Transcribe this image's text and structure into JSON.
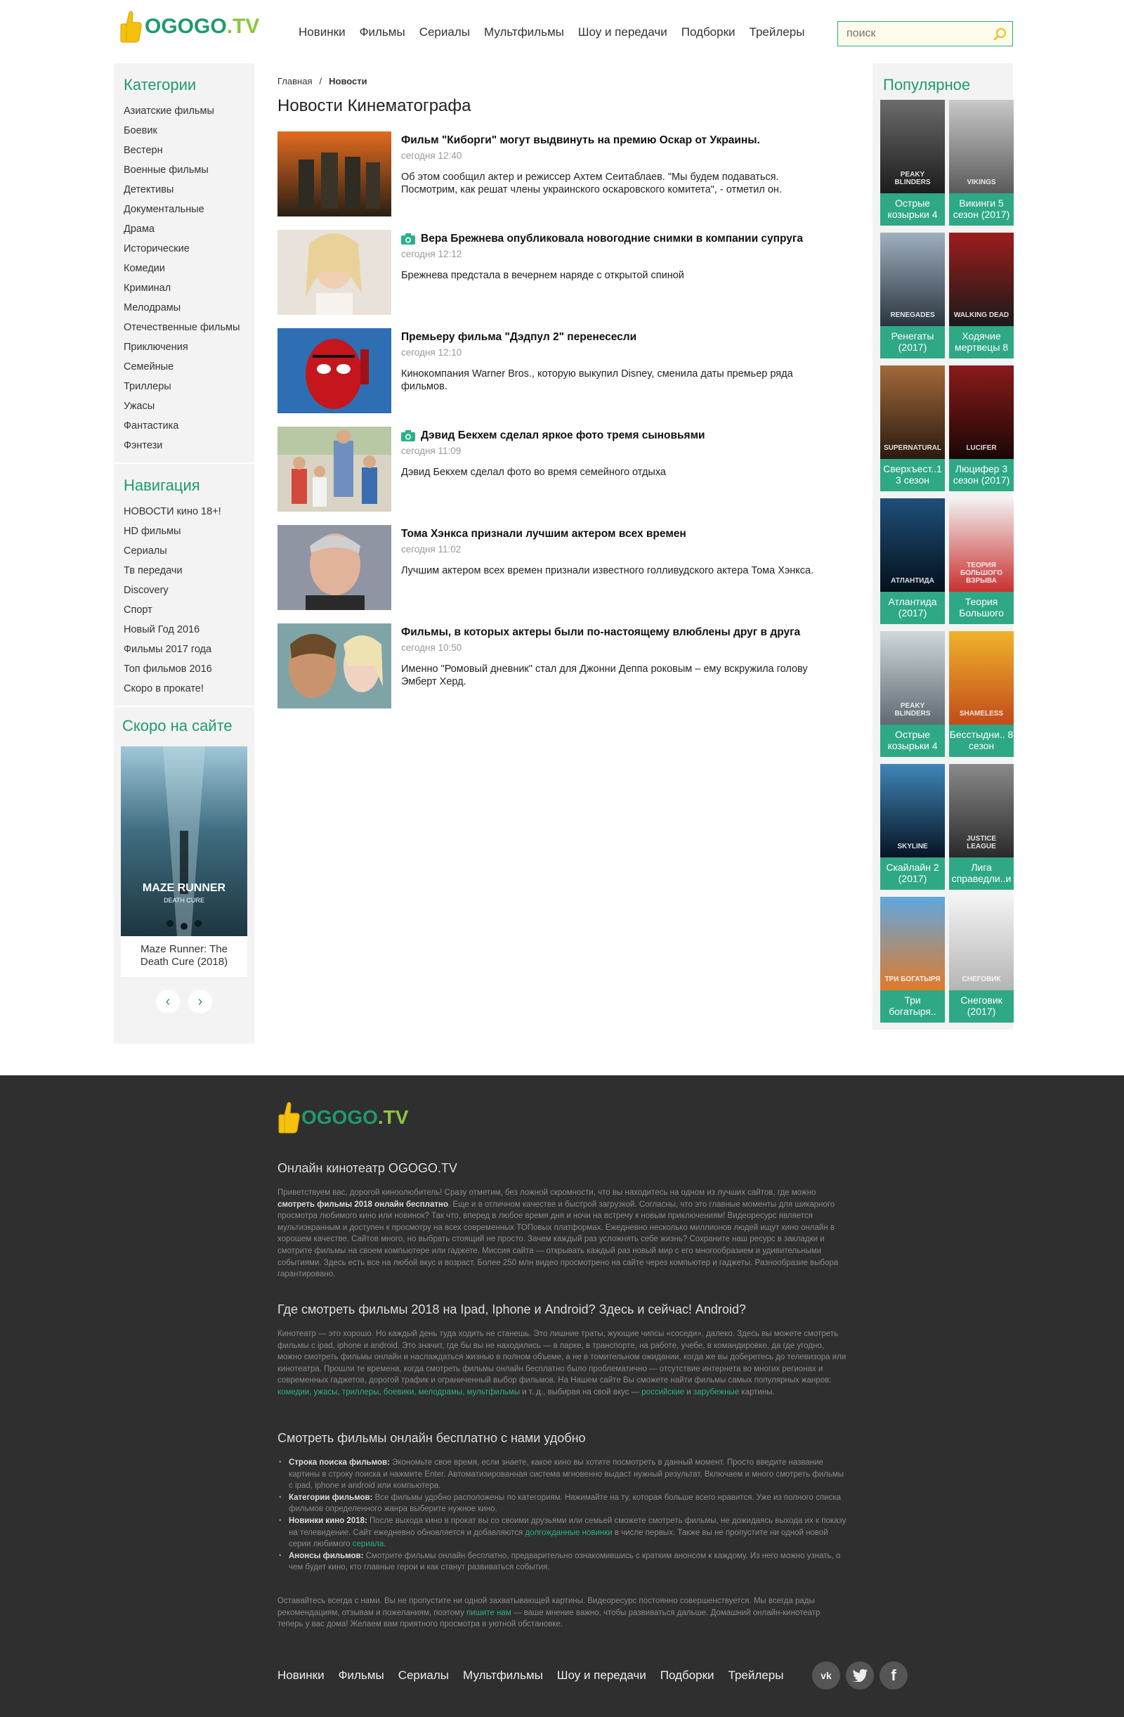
{
  "logo": {
    "part1": "OGOGO",
    "part2": ".TV"
  },
  "topnav": [
    "Новинки",
    "Фильмы",
    "Сериалы",
    "Мультфильмы",
    "Шоу и передачи",
    "Подборки",
    "Трейлеры"
  ],
  "search": {
    "placeholder": "поиск"
  },
  "categories": {
    "title": "Категории",
    "items": [
      "Азиатские фильмы",
      "Боевик",
      "Вестерн",
      "Военные фильмы",
      "Детективы",
      "Документальные",
      "Драма",
      "Исторические",
      "Комедии",
      "Криминал",
      "Мелодрамы",
      "Отечественные фильмы",
      "Приключения",
      "Семейные",
      "Триллеры",
      "Ужасы",
      "Фантастика",
      "Фэнтези"
    ]
  },
  "navigation": {
    "title": "Навигация",
    "items": [
      "НОВОСТИ кино 18+!",
      "HD фильмы",
      "Сериалы",
      "Тв передачи",
      "Discovery",
      "Спорт",
      "Новый Год 2016",
      "Фильмы 2017 года",
      "Топ фильмов 2016",
      "Скоро в прокате!"
    ]
  },
  "soon": {
    "title": "Скоро на сайте",
    "card_title": "Maze Runner: The Death Cure (2018)",
    "poster_text": "MAZE RUNNER",
    "poster_sub": "DEATH CURE"
  },
  "breadcrumb": {
    "home": "Главная",
    "separator": "/",
    "current": "Новости"
  },
  "page_title": "Новости Кинематографа",
  "news": [
    {
      "title": "Фильм \"Киборги\" могут выдвинуть на премию Оскар от Украины.",
      "time": "сегодня 12:40",
      "desc": "Об этом сообщил актер и режиссер Ахтем Сеитаблаев. \"Мы будем подаваться. Посмотрим, как решат члены украинского оскаровского комитета\", - отметил он.",
      "photo": false
    },
    {
      "title": "Вера Брежнева опубликовала новогодние снимки в компании супруга",
      "time": "сегодня 12:12",
      "desc": "Брежнева предстала в вечернем наряде с открытой спиной",
      "photo": true
    },
    {
      "title": "Премьеру фильма \"Дэдпул 2\" перенесесли",
      "time": "сегодня 12:10",
      "desc": "Кинокомпания Warner Bros., которую выкупил Disney, сменила даты премьер ряда фильмов.",
      "photo": false
    },
    {
      "title": "Дэвид Бекхем сделал яркое фото тремя сыновьями",
      "time": "сегодня 11:09",
      "desc": "Дэвид Бекхем сделал фото во время семейного отдыха",
      "photo": true
    },
    {
      "title": "Тома Хэнкса признали лучшим актером всех времен",
      "time": "сегодня 11:02",
      "desc": "Лучшим актером всех времен признали известного голливудского актера Тома Хэнкса.",
      "photo": false
    },
    {
      "title": "Фильмы, в которых актеры были по-настоящему влюблены друг в друга",
      "time": "сегодня 10:50",
      "desc": "Именно \"Ромовый дневник\" стал для Джонни Деппа роковым – ему вскружила голову Эмберт Херд.",
      "photo": false
    }
  ],
  "popular": {
    "title": "Популярное",
    "items": [
      {
        "title": "Острые козырьки 4",
        "color1": "#6b6b6b",
        "color2": "#1c1c1c",
        "poster_text": "PEAKY BLINDERS"
      },
      {
        "title": "Викинги 5 сезон (2017)",
        "color1": "#c9c9c9",
        "color2": "#5a5a5a",
        "poster_text": "VIKINGS"
      },
      {
        "title": "Ренегаты (2017)",
        "color1": "#9fb0be",
        "color2": "#2a3440",
        "poster_text": "RENEGADES"
      },
      {
        "title": "Ходячие мертвецы 8",
        "color1": "#9e1c1c",
        "color2": "#1a1a1a",
        "poster_text": "WALKING DEAD"
      },
      {
        "title": "Сверхъест..1 3 сезон",
        "color1": "#a36a3a",
        "color2": "#2a1a10",
        "poster_text": "SUPERNATURAL"
      },
      {
        "title": "Люцифер 3 сезон (2017)",
        "color1": "#8c1a1a",
        "color2": "#1a0606",
        "poster_text": "LUCIFER"
      },
      {
        "title": "Атлантида (2017)",
        "color1": "#1f4f7a",
        "color2": "#04101c",
        "poster_text": "АТЛАНТИДА"
      },
      {
        "title": "Теория Большого",
        "color1": "#f2f2f2",
        "color2": "#c93030",
        "poster_text": "ТЕОРИЯ БОЛЬШОГО ВЗРЫВА"
      },
      {
        "title": "Острые козырьки 4",
        "color1": "#cfd8dc",
        "color2": "#5d6a70",
        "poster_text": "PEAKY BLINDERS"
      },
      {
        "title": "Бесстыдни.. 8 сезон",
        "color1": "#f0b32a",
        "color2": "#c24b1c",
        "poster_text": "SHAMELESS"
      },
      {
        "title": "Скайлайн 2 (2017)",
        "color1": "#3f86b8",
        "color2": "#061424",
        "poster_text": "SKYLINE"
      },
      {
        "title": "Лига справедли..и",
        "color1": "#8a8a8a",
        "color2": "#2a2a2a",
        "poster_text": "JUSTICE LEAGUE"
      },
      {
        "title": "Три богатыря..",
        "color1": "#5fa8e0",
        "color2": "#e07a2a",
        "poster_text": "ТРИ БОГАТЫРЯ"
      },
      {
        "title": "Снеговик (2017)",
        "color1": "#f2f2f2",
        "color2": "#b5b5b5",
        "poster_text": "СНЕГОВИК"
      }
    ]
  },
  "footer": {
    "h1": "Онлайн кинотеатр OGOGO.TV",
    "p1_a": "Приветствуем вас, дорогой киноолюбитель! Сразу отметим, без ложной скромности, что вы находитесь на одном из лучших сайтов, где можно ",
    "p1_b": "смотреть фильмы 2018 онлайн бесплатно",
    "p1_c": ". Еще и в отличном качестве и быстрой загрузкой. Согласны, что это главные моменты для шикарного просмотра любимого кино или новинок? Так что, вперед в любое время дня и ночи на встречу к новым приключениям! Видеоресурс является мультиэкранным и доступен к просмотру на всех современных ТОПовых платформах. Ежедневно несколько миллионов людей ищут кино онлайн в хорошем качестве. Сайтов много, но выбрать стоящий не просто. Зачем каждый раз усложнять себе жизнь? Сохраните наш ресурс в закладки и смотрите фильмы на своем компьютере или гаджете. Миссия сайта — открывать каждый раз новый мир с его многообразием и удивительными событиями. Здесь есть все на любой вкус и возраст. Более 250 млн видео просмотрено на сайте через компьютер и гаджеты. Разнообразие выбора гарантировано.",
    "h2": "Где смотреть фильмы 2018 на Ipad, Iphone и Android? Здесь и сейчас! Android?",
    "p2_a": "Кинотеатр — это хорошо. Но каждый день туда ходить не станешь. Это лишние траты, жующие чипсы «соседи», далеко. Здесь вы можете смотреть фильмы с ipad, iphone и android. Это значит, где бы вы не находились — в парке, в транспорте, на работе, учебе, в командировке, да где угодно, можно смотреть фильмы онлайн и наслаждаться жизнью в полном объеме, а не в томительном ожидании, когда же вы доберетесь до телевизора или кинотеатра. Прошли те времена, когда смотреть фильмы онлайн бесплатно было проблематично — отсутствие интернета во многих регионах и современных гаджетов, дорогой трафик и ограниченный выбор фильмов. На Нашем сайте Вы сможете найти фильмы самых популярных жанров: ",
    "p2_links": "комедии, ужасы, триллеры, боевики, мелодрамы, мультфильмы",
    "p2_b": " и т. д., выбирая на свой вкус — ",
    "p2_link2": "российские",
    "p2_c": " и ",
    "p2_link3": "зарубежные",
    "p2_d": " картины.",
    "h3": "Смотреть фильмы онлайн бесплатно с нами удобно",
    "list": [
      {
        "b": "Строка поиска фильмов:",
        "t": " Экономьте свое время, если знаете, какое кино вы хотите посмотреть в данный момент. Просто введите название картины в строку поиска и нажмите Enter. Автоматизированная система мгновенно выдаст нужный результат. Включаем и много смотреть фильмы с ipad, iphone и android или компьютера."
      },
      {
        "b": "Категории фильмов:",
        "t": " Все фильмы удобно расположены по категориям. Нажимайте на ту, которая больше всего нравится. Уже из полного списка фильмов определенного жанра выберите нужное кино."
      },
      {
        "b": "Новинки кино 2018:",
        "t": " После выхода кино в прокат вы со своими друзьями или семьей сможете смотреть фильмы, не дожидаясь выхода их к показу на телевидение. Сайт ежедневно обновляется и добавляются ",
        "l": "долгожданные новинки",
        "t2": " в числе первых. Также вы не пропустите ни одной новой серии любимого ",
        "l2": "сериала",
        "t3": "."
      },
      {
        "b": "Анонсы фильмов:",
        "t": " Смотрите фильмы онлайн бесплатно, предварительно ознакомившись с кратким анонсом к каждому. Из него можно узнать, о чем будет кино, кто главные герои и как станут развиваться события."
      }
    ],
    "p4_a": "Оставайтесь всегда с нами.  Вы не пропустите ни одной захватывающей картины. Видеоресурс постоянно совершенствуется. Мы всегда рады рекомендациям, отзывам и пожеланиям, поэтому ",
    "p4_link": "пишите нам",
    "p4_b": " — ваше мнение важно, чтобы развиваться дальше. Домашний онлайн-кинотеатр теперь у вас дома! Желаем вам приятного просмотра в уютной обстановке.",
    "nav": [
      "Новинки",
      "Фильмы",
      "Сериалы",
      "Мультфильмы",
      "Шоу и передачи",
      "Подборки",
      "Трейлеры"
    ],
    "social": [
      "vk",
      "twitter",
      "facebook"
    ],
    "social_labels": {
      "vk": "vk",
      "twitter": "t",
      "facebook": "f"
    }
  },
  "colors": {
    "accent": "#1e9a6d",
    "brand_yellow": "#8cc63f",
    "popular_bg": "#2fa886",
    "footer_bg": "#2f2f2f"
  }
}
